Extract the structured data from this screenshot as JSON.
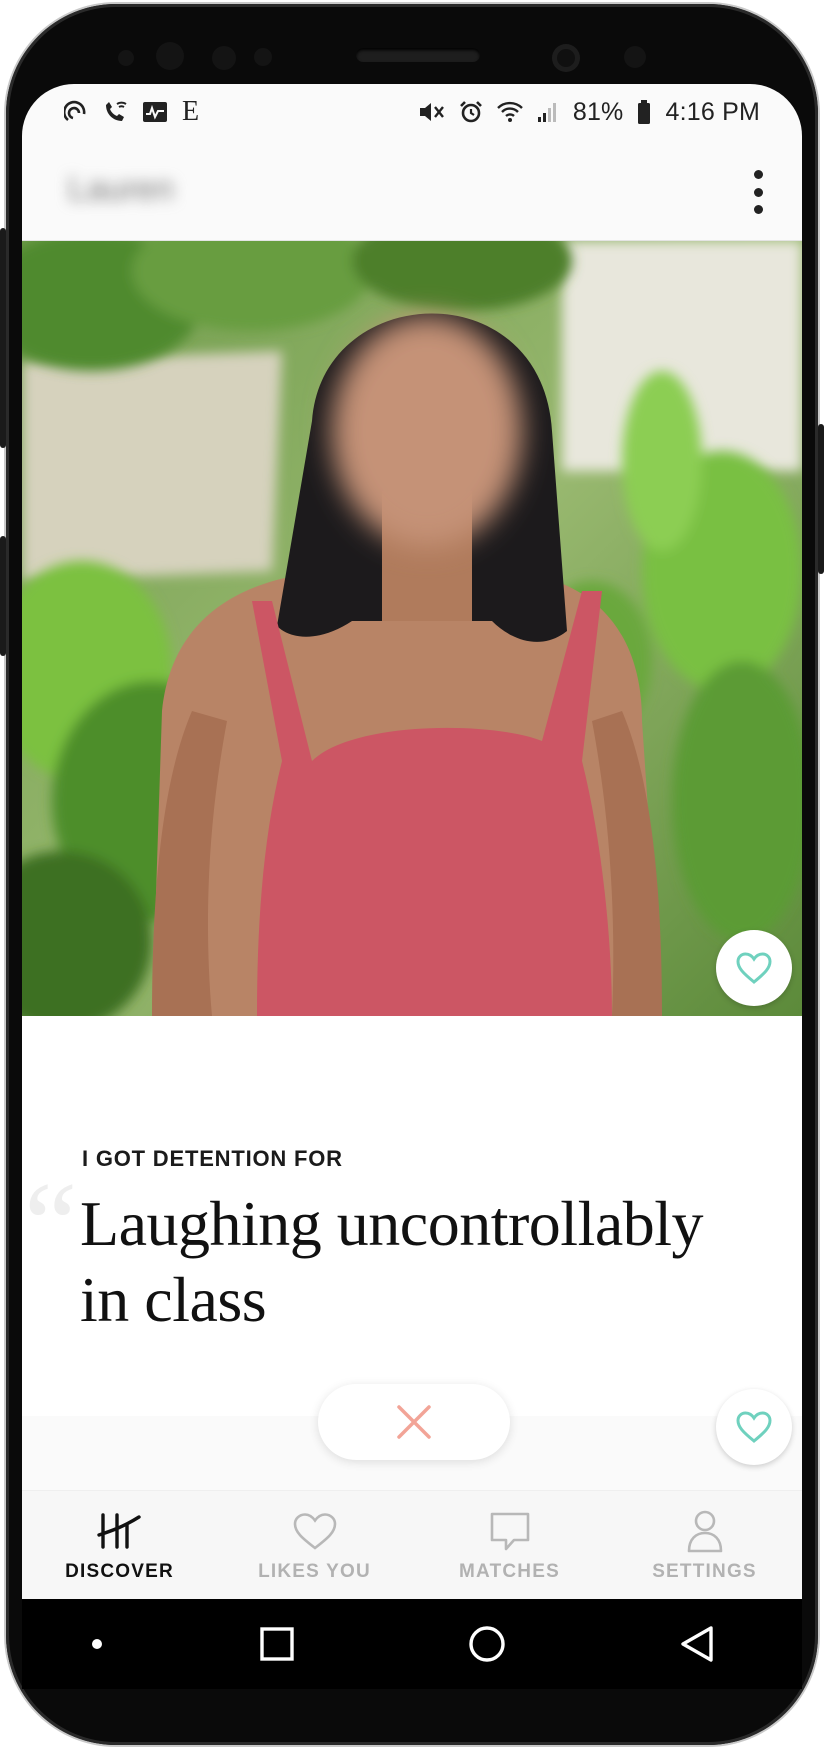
{
  "status_bar": {
    "left_icons": [
      "hinge-notification-icon",
      "wifi-call-icon",
      "activity-icon",
      "e-letter-icon"
    ],
    "e_letter": "E",
    "right_icons": [
      "mute-vibrate-icon",
      "alarm-icon",
      "wifi-icon",
      "signal-icon"
    ],
    "battery": "81%",
    "time": "4:16 PM"
  },
  "app_bar": {
    "profile_name": "Lauren",
    "menu_icon": "more-vertical-icon"
  },
  "profile_card": {
    "prompt_label": "I GOT DETENTION FOR",
    "answer": "Laughing uncontrollably in class",
    "quote_mark": "“"
  },
  "actions": {
    "skip_icon": "close-icon",
    "like_icon": "heart-icon"
  },
  "tabs": [
    {
      "label": "DISCOVER",
      "icon": "hinge-logo-icon",
      "active": true
    },
    {
      "label": "LIKES YOU",
      "icon": "heart-outline-icon",
      "active": false
    },
    {
      "label": "MATCHES",
      "icon": "chat-bubble-icon",
      "active": false
    },
    {
      "label": "SETTINGS",
      "icon": "person-icon",
      "active": false
    }
  ],
  "system_nav": [
    "recents-button",
    "home-button",
    "back-button"
  ],
  "colors": {
    "accent_teal": "#6fd1be",
    "skip_pink": "#f2a497",
    "tab_active": "#111111",
    "tab_inactive": "#b2b2b2"
  }
}
